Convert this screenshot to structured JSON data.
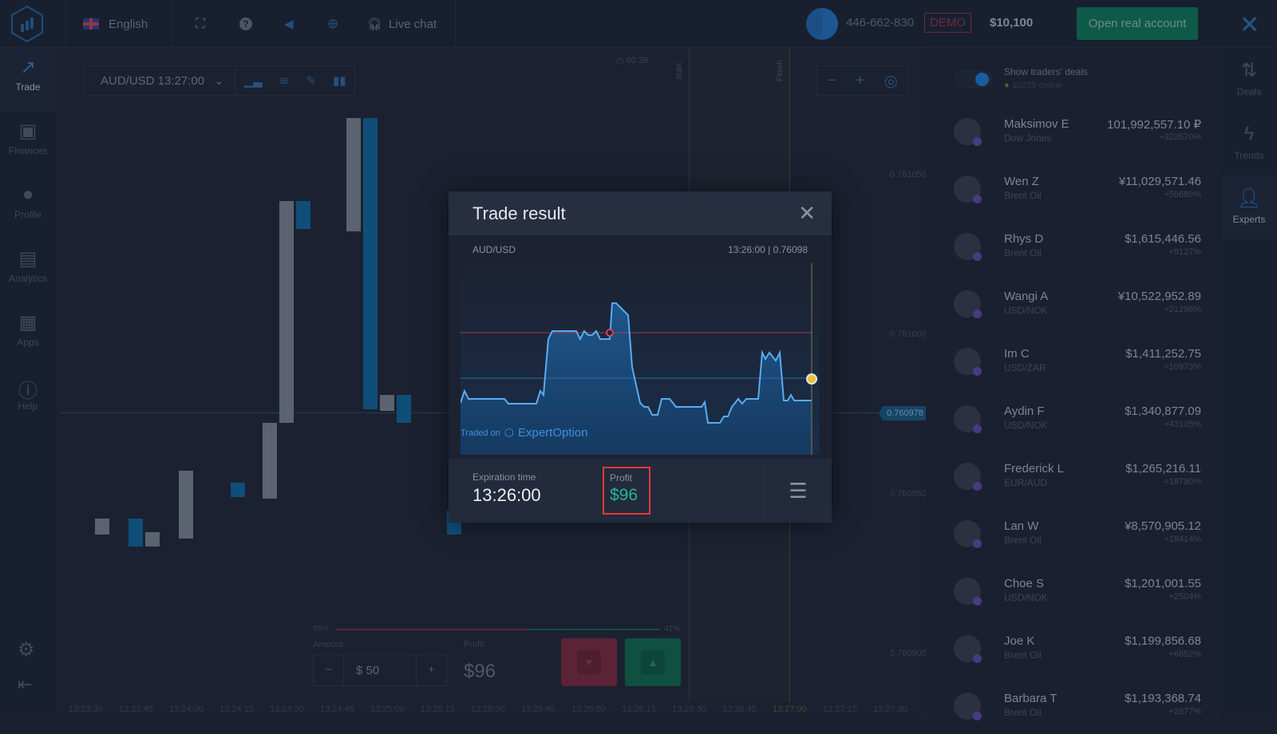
{
  "topbar": {
    "language": "English",
    "live_chat": "Live chat",
    "account_id": "446-662-830",
    "account_mode": "DEMO",
    "balance": "$10,100",
    "open_real_account": "Open real account"
  },
  "left_nav": [
    {
      "label": "Trade",
      "icon": "trend-up-icon",
      "active": true
    },
    {
      "label": "Finances",
      "icon": "banknote-icon"
    },
    {
      "label": "Profile",
      "icon": "user-icon"
    },
    {
      "label": "Analytics",
      "icon": "document-icon"
    },
    {
      "label": "Apps",
      "icon": "grid-icon"
    },
    {
      "label": "Help",
      "icon": "info-icon"
    }
  ],
  "chart": {
    "asset_selector": "AUD/USD 13:27:00",
    "timer": "00:26",
    "start_label": "Start",
    "finish_label": "Finish",
    "price_labels": [
      "0.761050",
      "0.761000",
      "0.760950",
      "0.760900"
    ],
    "current_price": "0.760978",
    "time_labels": [
      "13:23:30",
      "13:23:45",
      "13:24:00",
      "13:24:15",
      "13:24:30",
      "13:24:45",
      "13:25:00",
      "13:25:15",
      "13:25:30",
      "13:25:45",
      "13:26:00",
      "13:26:15",
      "13:26:30",
      "13:26:45",
      "13:27:00",
      "13:27:15",
      "13:27:30"
    ]
  },
  "trade_panel": {
    "sentiment_down": "59%",
    "sentiment_up": "41%",
    "sentiment_down_fraction": 0.59,
    "amount_label": "Amount",
    "amount_value": "$ 50",
    "profit_label": "Profit",
    "profit_value": "$96"
  },
  "modal": {
    "title": "Trade result",
    "asset": "AUD/USD",
    "time_price": "13:26:00 | 0.76098",
    "traded_on": "Traded on",
    "brand": "ExpertOption",
    "expiration_label": "Expiration time",
    "expiration_value": "13:26:00",
    "profit_label": "Profit",
    "profit_value": "$96"
  },
  "right_panel": {
    "show_deals": "Show traders' deals",
    "online": "10239 online",
    "traders": [
      {
        "name": "Maksimov E",
        "asset": "Dow Jones",
        "amount": "101,992,557.10 ₽",
        "pct": "+323570%"
      },
      {
        "name": "Wen Z",
        "asset": "Brent Oil",
        "amount": "¥11,029,571.46",
        "pct": "+58689%"
      },
      {
        "name": "Rhys D",
        "asset": "Brent Oil",
        "amount": "$1,615,446.56",
        "pct": "+9127%"
      },
      {
        "name": "Wangi A",
        "asset": "USD/NOK",
        "amount": "¥10,522,952.89",
        "pct": "+21296%"
      },
      {
        "name": "Im C",
        "asset": "USD/ZAR",
        "amount": "$1,411,252.75",
        "pct": "+10973%"
      },
      {
        "name": "Aydin F",
        "asset": "USD/NOK",
        "amount": "$1,340,877.09",
        "pct": "+43105%"
      },
      {
        "name": "Frederick L",
        "asset": "EUR/AUD",
        "amount": "$1,265,216.11",
        "pct": "+18790%"
      },
      {
        "name": "Lan W",
        "asset": "Brent Oil",
        "amount": "¥8,570,905.12",
        "pct": "+18414%"
      },
      {
        "name": "Choe S",
        "asset": "USD/NOK",
        "amount": "$1,201,001.55",
        "pct": "+2504%"
      },
      {
        "name": "Joe K",
        "asset": "Brent Oil",
        "amount": "$1,199,856.68",
        "pct": "+6652%"
      },
      {
        "name": "Barbara T",
        "asset": "Brent Oil",
        "amount": "$1,193,368.74",
        "pct": "+2677%"
      }
    ]
  },
  "right_nav": [
    {
      "label": "Deals",
      "icon": "arrows-updown-icon"
    },
    {
      "label": "Trends",
      "icon": "lightning-icon"
    },
    {
      "label": "Experts",
      "icon": "add-user-icon",
      "active": true
    }
  ]
}
